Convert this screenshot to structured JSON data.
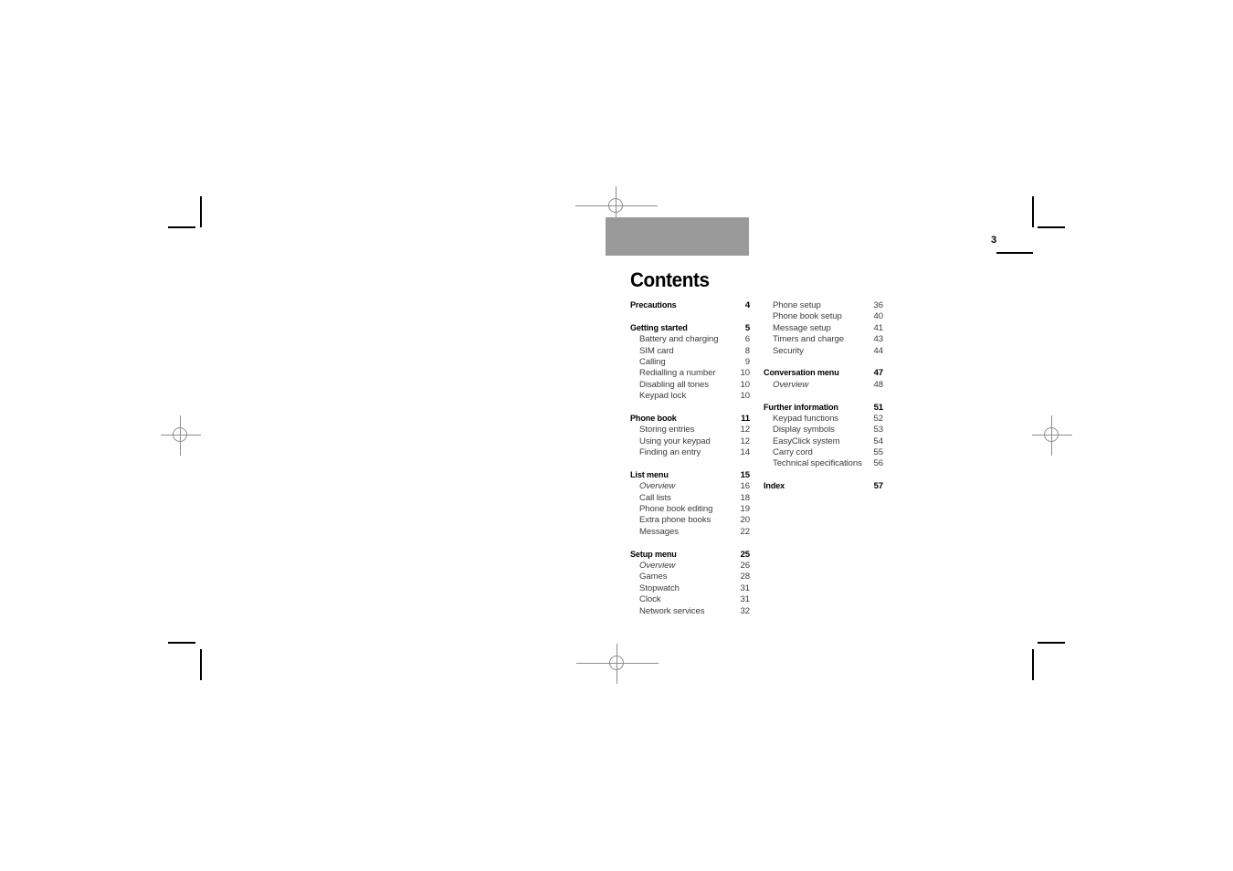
{
  "page": {
    "folio": "3",
    "title": "Contents",
    "banner_color": "#9a9a9a"
  },
  "contents": {
    "left_column": [
      {
        "label": "Precautions",
        "page": "4",
        "type": "head"
      },
      {
        "type": "gap"
      },
      {
        "label": "Getting started",
        "page": "5",
        "type": "head"
      },
      {
        "label": "Battery and charging",
        "page": "6",
        "type": "sub"
      },
      {
        "label": "SIM card",
        "page": "8",
        "type": "sub"
      },
      {
        "label": "Calling",
        "page": "9",
        "type": "sub"
      },
      {
        "label": "Redialling a number",
        "page": "10",
        "type": "sub"
      },
      {
        "label": "Disabling all tones",
        "page": "10",
        "type": "sub"
      },
      {
        "label": "Keypad lock",
        "page": "10",
        "type": "sub"
      },
      {
        "type": "gap"
      },
      {
        "label": "Phone book",
        "page": "11",
        "type": "head"
      },
      {
        "label": "Storing entries",
        "page": "12",
        "type": "sub"
      },
      {
        "label": "Using your keypad",
        "page": "12",
        "type": "sub"
      },
      {
        "label": "Finding an entry",
        "page": "14",
        "type": "sub"
      },
      {
        "type": "gap"
      },
      {
        "label": "List menu",
        "page": "15",
        "type": "head"
      },
      {
        "label": "Overview",
        "page": "16",
        "type": "sub",
        "italic": true
      },
      {
        "label": "Call lists",
        "page": "18",
        "type": "sub"
      },
      {
        "label": "Phone book editing",
        "page": "19",
        "type": "sub"
      },
      {
        "label": "Extra phone books",
        "page": "20",
        "type": "sub"
      },
      {
        "label": "Messages",
        "page": "22",
        "type": "sub"
      },
      {
        "type": "gap"
      },
      {
        "label": "Setup menu",
        "page": "25",
        "type": "head"
      },
      {
        "label": "Overview",
        "page": "26",
        "type": "sub",
        "italic": true
      },
      {
        "label": "Games",
        "page": "28",
        "type": "sub"
      },
      {
        "label": "Stopwatch",
        "page": "31",
        "type": "sub"
      },
      {
        "label": "Clock",
        "page": "31",
        "type": "sub"
      },
      {
        "label": "Network services",
        "page": "32",
        "type": "sub"
      }
    ],
    "right_column": [
      {
        "label": "Phone setup",
        "page": "36",
        "type": "sub"
      },
      {
        "label": "Phone book setup",
        "page": "40",
        "type": "sub"
      },
      {
        "label": "Message setup",
        "page": "41",
        "type": "sub"
      },
      {
        "label": "Timers and charge",
        "page": "43",
        "type": "sub"
      },
      {
        "label": "Security",
        "page": "44",
        "type": "sub"
      },
      {
        "type": "gap"
      },
      {
        "label": "Conversation menu",
        "page": "47",
        "type": "head"
      },
      {
        "label": "Overview",
        "page": "48",
        "type": "sub",
        "italic": true
      },
      {
        "type": "gap"
      },
      {
        "label": "Further information",
        "page": "51",
        "type": "head"
      },
      {
        "label": "Keypad functions",
        "page": "52",
        "type": "sub"
      },
      {
        "label": "Display symbols",
        "page": "53",
        "type": "sub"
      },
      {
        "label": "EasyClick system",
        "page": "54",
        "type": "sub"
      },
      {
        "label": "Carry cord",
        "page": "55",
        "type": "sub"
      },
      {
        "label": "Technical specifications",
        "page": "56",
        "type": "sub"
      },
      {
        "type": "gap"
      },
      {
        "label": "Index",
        "page": "57",
        "type": "head"
      }
    ]
  }
}
